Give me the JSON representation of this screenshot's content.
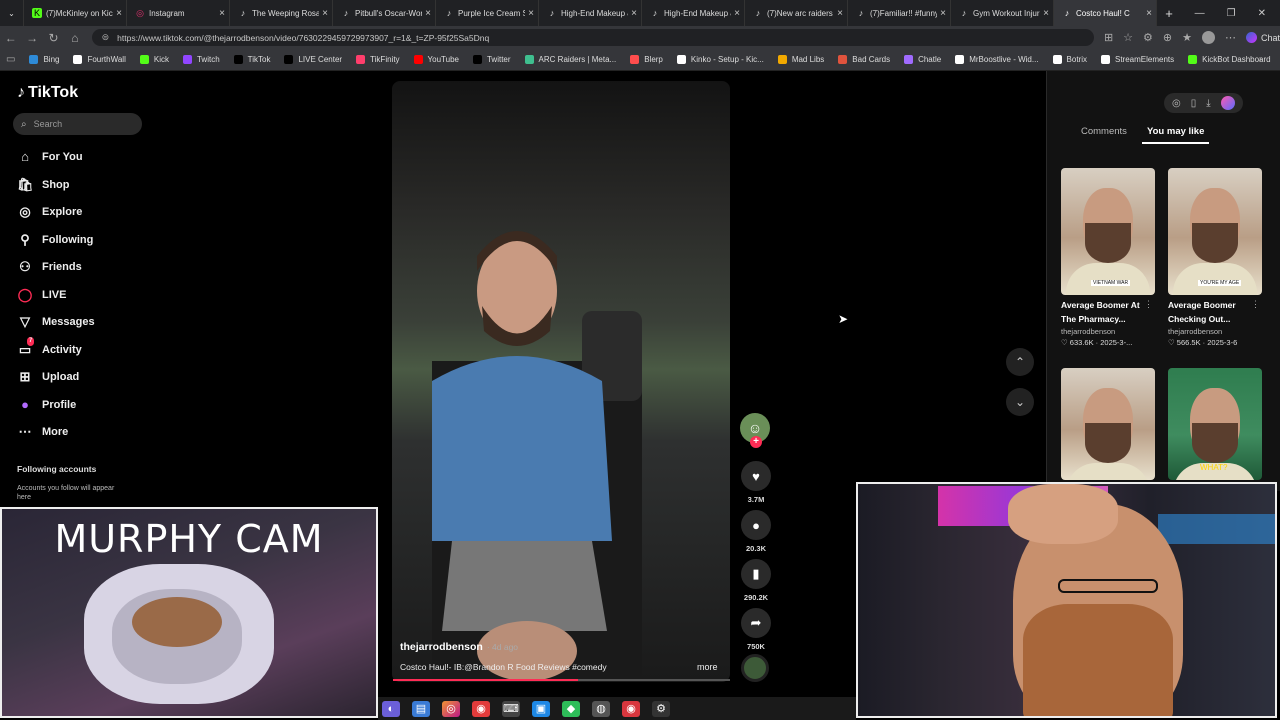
{
  "browser": {
    "tabs": [
      {
        "icon": "kick-icon",
        "title": "(7)McKinley on Kick"
      },
      {
        "icon": "instagram-icon",
        "title": "Instagram"
      },
      {
        "icon": "tiktok-icon",
        "title": "The Weeping Rosar"
      },
      {
        "icon": "tiktok-icon",
        "title": "Pitbull's Oscar-Wor"
      },
      {
        "icon": "tiktok-icon",
        "title": "Purple Ice Cream Sc"
      },
      {
        "icon": "tiktok-icon",
        "title": "High-End Makeup &"
      },
      {
        "icon": "tiktok-icon",
        "title": "High-End Makeup &"
      },
      {
        "icon": "tiktok-icon",
        "title": "(7)New arc raiders g"
      },
      {
        "icon": "tiktok-icon",
        "title": "(7)Familiar!! #funny"
      },
      {
        "icon": "tiktok-icon",
        "title": "Gym Workout Injur"
      },
      {
        "icon": "tiktok-icon",
        "title": "Costco Haul! C"
      }
    ],
    "active_tab_index": 10,
    "url": "https://www.tiktok.com/@thejarrodbenson/video/7630229459729973907_r=1&_t=ZP-95f25Sa5Dnq",
    "chat_label": "Chat",
    "bookmarks": [
      {
        "label": "Bing",
        "color": "#2e8bd8"
      },
      {
        "label": "FourthWall",
        "color": "#ffffff"
      },
      {
        "label": "Kick",
        "color": "#53fc18"
      },
      {
        "label": "Twitch",
        "color": "#9146ff"
      },
      {
        "label": "TikTok",
        "color": "#000000"
      },
      {
        "label": "LIVE Center",
        "color": "#000000"
      },
      {
        "label": "TikFinity",
        "color": "#ff3e6c"
      },
      {
        "label": "YouTube",
        "color": "#ff0000"
      },
      {
        "label": "Twitter",
        "color": "#000000"
      },
      {
        "label": "ARC Raiders | Meta...",
        "color": "#3fbf8f"
      },
      {
        "label": "Blerp",
        "color": "#ff4d4d"
      },
      {
        "label": "Kinko - Setup - Kic...",
        "color": "#ffffff"
      },
      {
        "label": "Mad Libs",
        "color": "#f2a900"
      },
      {
        "label": "Bad Cards",
        "color": "#e0533d"
      },
      {
        "label": "Chatle",
        "color": "#a06bff"
      },
      {
        "label": "MrBoostlive - Wid...",
        "color": "#ffffff"
      },
      {
        "label": "Botrix",
        "color": "#ffffff"
      },
      {
        "label": "StreamElements",
        "color": "#ffffff"
      },
      {
        "label": "KickBot Dashboard",
        "color": "#53fc18"
      }
    ]
  },
  "tiktok": {
    "logo_text": "TikTok",
    "search_placeholder": "Search",
    "nav": [
      {
        "label": "For You",
        "icon": "home-icon"
      },
      {
        "label": "Shop",
        "icon": "shop-icon"
      },
      {
        "label": "Explore",
        "icon": "compass-icon"
      },
      {
        "label": "Following",
        "icon": "following-icon"
      },
      {
        "label": "Friends",
        "icon": "friends-icon"
      },
      {
        "label": "LIVE",
        "icon": "live-icon"
      },
      {
        "label": "Messages",
        "icon": "messages-icon"
      },
      {
        "label": "Activity",
        "icon": "activity-icon",
        "badge": "7"
      },
      {
        "label": "Upload",
        "icon": "upload-icon"
      },
      {
        "label": "Profile",
        "icon": "profile-avatar"
      },
      {
        "label": "More",
        "icon": "more-icon"
      }
    ],
    "following_accounts_title": "Following accounts",
    "following_accounts_text": "Accounts you follow will appear here"
  },
  "video": {
    "username": "thejarrodbenson",
    "age": "· 4d ago",
    "caption": "Costco Haul!- IB:@Brandon R Food Reviews #comedy",
    "more_label": "more",
    "progress": 0.55,
    "likes": "3.7M",
    "comments": "20.3K",
    "saves": "290.2K",
    "shares": "750K"
  },
  "right_panel": {
    "tab_comments": "Comments",
    "tab_you_may_like": "You may like",
    "cards": [
      {
        "title": "Average Boomer At The Pharmacy...",
        "user": "thejarrodbenson",
        "stats": "♡ 633.6K · 2025-3-...",
        "tag": "VIETNAM WAR"
      },
      {
        "title": "Average Boomer Checking Out...",
        "user": "thejarrodbenson",
        "stats": "♡ 566.5K · 2025-3-6",
        "tag": "YOU'RE MY AGE"
      },
      {
        "title": "",
        "user": "",
        "stats": "",
        "tag": ""
      },
      {
        "title": "",
        "user": "",
        "stats": "",
        "tag": "WHAT?"
      }
    ]
  },
  "overlays": {
    "murphy_cam_title": "MURPHY CAM"
  }
}
